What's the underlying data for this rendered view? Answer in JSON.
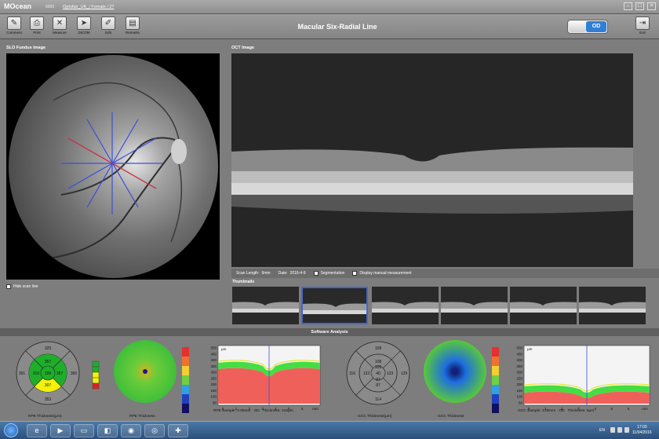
{
  "app": {
    "logo": "MOcean",
    "model": "6000",
    "patient": "Optofair_UK_/ Female / 2?"
  },
  "toolbar": {
    "tools": [
      {
        "label": "Comment",
        "icon": "comment-icon"
      },
      {
        "label": "Print",
        "icon": "print-icon"
      },
      {
        "label": "Measure",
        "icon": "measure-icon"
      },
      {
        "label": "DICOM",
        "icon": "send-icon"
      },
      {
        "label": "Edit",
        "icon": "edit-icon"
      },
      {
        "label": "Remarks",
        "icon": "remarks-icon"
      }
    ],
    "title": "Macular Six-Radial Line",
    "eye": "OD",
    "exit": "Exit"
  },
  "slo": {
    "title": "SLO Fundus Image",
    "hide_scan_line": "Hide scan line"
  },
  "oct": {
    "title": "OCT Image",
    "scan_length_label": "Scan Length:",
    "scan_length": "6mm",
    "date_label": "Date:",
    "date": "2016-4-9",
    "segmentation": "Segmentation",
    "display_manual": "Display manual measurement"
  },
  "thumbnails": {
    "title": "Thumbnails",
    "count": 6,
    "selected_index": 1
  },
  "software_analysis": {
    "title": "Software Analysis",
    "rpe_chart": {
      "caption": "RPE Thickness(μm)",
      "center": "199",
      "inner": [
        "357",
        "310",
        "307",
        "357"
      ],
      "outer": [
        "329",
        "391",
        "353",
        "365"
      ]
    },
    "rpe_map_caption": "RPE Thickness",
    "rpe_profile": {
      "y_unit": "μm",
      "y_ticks": [
        "550",
        "450",
        "400",
        "350",
        "300",
        "250",
        "200",
        "150",
        "100",
        "50"
      ],
      "x_ticks": [
        "0",
        "1",
        "2",
        "3",
        "4",
        "5",
        "6",
        "mm"
      ],
      "sample_label": "RPE  Sample:",
      "sample": "3.00mm",
      "eye": "OD",
      "thickness_label": "Thickness:",
      "thickness": "216μm"
    },
    "gcc_chart": {
      "caption": "GCC Thickness(μm)",
      "center": "40",
      "inner": [
        "108",
        "122",
        "87",
        "123"
      ],
      "outer": [
        "108",
        "116",
        "114",
        "129"
      ],
      "ring2": [
        "105",
        "97"
      ]
    },
    "gcc_map_caption": "GCC Thickness",
    "gcc_profile": {
      "y_unit": "μm",
      "y_ticks": [
        "500",
        "450",
        "400",
        "350",
        "300",
        "250",
        "200",
        "150",
        "100",
        "50"
      ],
      "x_ticks": [
        "0",
        "1",
        "2",
        "3",
        "4",
        "5",
        "6",
        "mm"
      ],
      "sample_label": "GCC  Sample:",
      "sample": "3.00mm",
      "eye": "OD",
      "thickness_label": "Thickness:",
      "thickness": "0μm"
    }
  },
  "taskbar": {
    "lang": "EN",
    "time": "17:03",
    "date": "11/04/2016"
  },
  "colors": {
    "accent": "#2f7fd6",
    "rpe_green": "#1fae2a",
    "rpe_yellow": "#f2f20a",
    "profile_red": "#f0605a",
    "profile_green": "#44dd44"
  }
}
